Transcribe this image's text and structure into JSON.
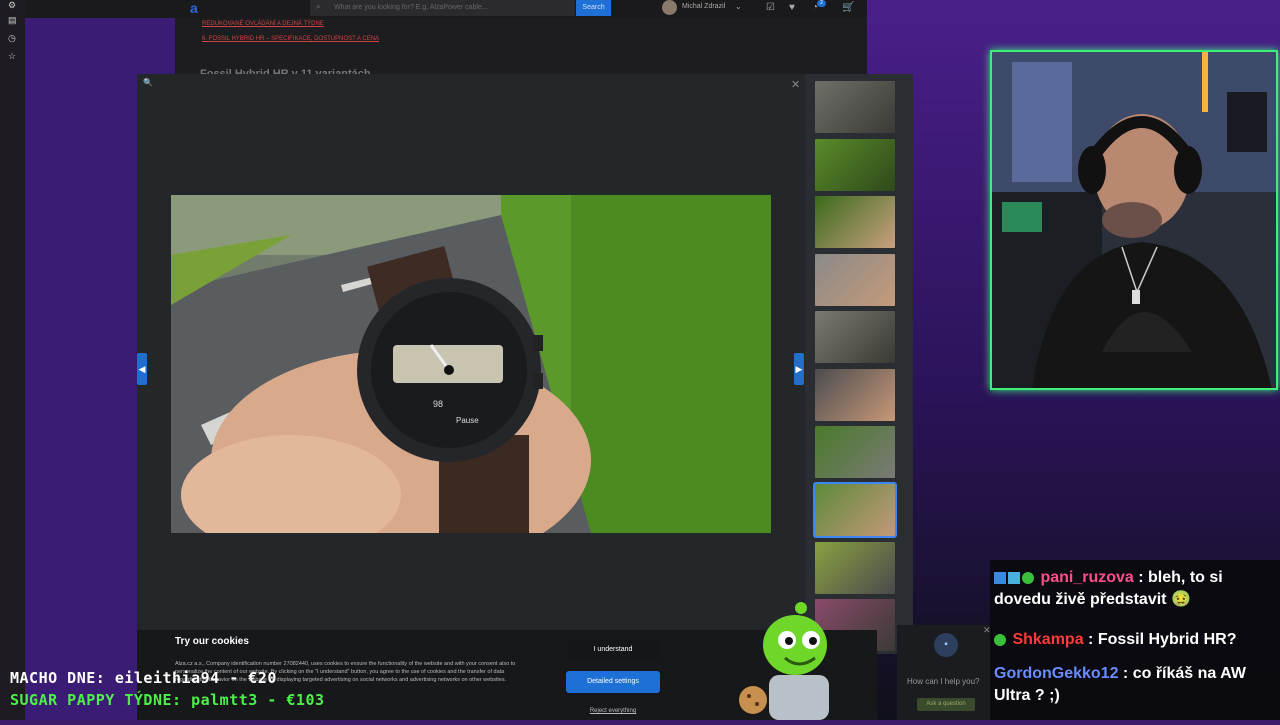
{
  "topbar": {
    "search_placeholder": "What are you looking for? E.g. AlzaPower cable...",
    "search_button": "Search",
    "user_name": "Michal Zdrazil",
    "cart_badge": "2"
  },
  "article": {
    "links": [
      "REDUKOVANÉ OVLÁDÁNÍ A DEJNÁ TÝDNE",
      "6. FOSSIL HYBRID HR – SPECIFIKACE, DOSTUPNOST A CENA"
    ],
    "heading": "Fossil Hybrid HR v 11 variantách"
  },
  "cookie": {
    "title": "Try our cookies",
    "text": "Alza.cz a.s., Company identification number 27082440, uses cookies to ensure the functionality of the website and with your consent also to personalize the content of our website. By clicking on the \"I understand\" button, you agree to the use of cookies and the transfer of data regarding the behavior on the website for displaying targeted advertising on social networks and advertising networks on other websites.",
    "understand_label": "I understand",
    "detailed_label": "Detailed settings",
    "reject_label": "Reject everything"
  },
  "chat_widget": {
    "help_text": "How can I help you?",
    "ask_label": "Ask a question"
  },
  "stream_chat": [
    {
      "user": "pani_ruzova",
      "user_color": "#ff4f8a",
      "message": " : bleh, to si dovedu živě představit 🤢"
    },
    {
      "user": "Shkampa",
      "user_color": "#ff3a3a",
      "message": " : Fossil Hybrid HR?"
    },
    {
      "user": "GordonGekko12",
      "user_color": "#6a8cff",
      "message": " : co říkáš na AW Ultra ? ;)"
    }
  ],
  "ticker": {
    "line1": "MACHO DNE: eileithia94 - €20",
    "line2": "SUGAR PAPPY TÝDNE: palmtt3 - €103"
  },
  "colors": {
    "accent": "#1e6fd6",
    "webcam_border": "#3cf07a",
    "ticker_green": "#4df04a"
  }
}
